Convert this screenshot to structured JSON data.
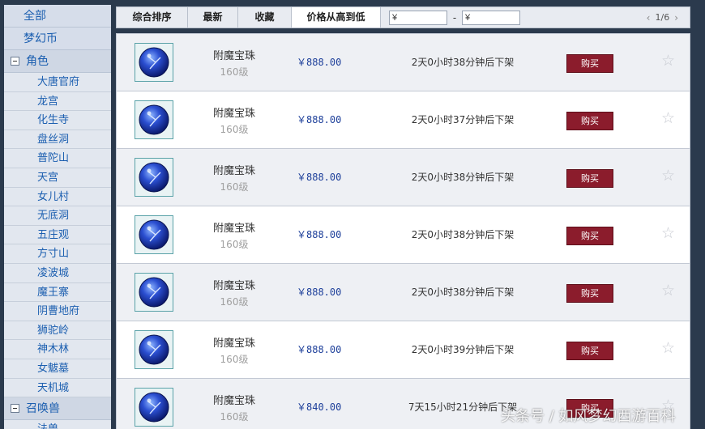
{
  "sidebar": {
    "top": [
      "全部",
      "梦幻币"
    ],
    "categories": [
      {
        "label": "角色",
        "items": [
          "大唐官府",
          "龙宫",
          "化生寺",
          "盘丝洞",
          "普陀山",
          "天宫",
          "女儿村",
          "无底洞",
          "五庄观",
          "方寸山",
          "凌波城",
          "魔王寨",
          "阴曹地府",
          "狮驼岭",
          "神木林",
          "女魃墓",
          "天机城"
        ]
      },
      {
        "label": "召唤兽",
        "items": [
          "法兽"
        ]
      }
    ]
  },
  "toolbar": {
    "tabs": [
      "综合排序",
      "最新",
      "收藏",
      "价格从高到低"
    ],
    "active_tab": 3,
    "price_min_value": "¥",
    "price_max_value": "¥",
    "price_sep": "-",
    "prev_icon": "chevron-left-icon",
    "next_icon": "chevron-right-icon",
    "page_indicator": "1/6"
  },
  "listings": [
    {
      "name": "附魔宝珠",
      "level": "160级",
      "price": "￥888.00",
      "time": "2天0小时38分钟后下架",
      "buy_label": "购买"
    },
    {
      "name": "附魔宝珠",
      "level": "160级",
      "price": "￥888.00",
      "time": "2天0小时37分钟后下架",
      "buy_label": "购买"
    },
    {
      "name": "附魔宝珠",
      "level": "160级",
      "price": "￥888.00",
      "time": "2天0小时38分钟后下架",
      "buy_label": "购买"
    },
    {
      "name": "附魔宝珠",
      "level": "160级",
      "price": "￥888.00",
      "time": "2天0小时38分钟后下架",
      "buy_label": "购买"
    },
    {
      "name": "附魔宝珠",
      "level": "160级",
      "price": "￥888.00",
      "time": "2天0小时38分钟后下架",
      "buy_label": "购买"
    },
    {
      "name": "附魔宝珠",
      "level": "160级",
      "price": "￥888.00",
      "time": "2天0小时39分钟后下架",
      "buy_label": "购买"
    },
    {
      "name": "附魔宝珠",
      "level": "160级",
      "price": "￥840.00",
      "time": "7天15小时21分钟后下架",
      "buy_label": "购买"
    }
  ],
  "watermark": "头条号 / 如风梦幻西游百科",
  "colors": {
    "accent": "#1c5fb0",
    "buy_button": "#8b1c2c",
    "price": "#1d3f9a"
  }
}
